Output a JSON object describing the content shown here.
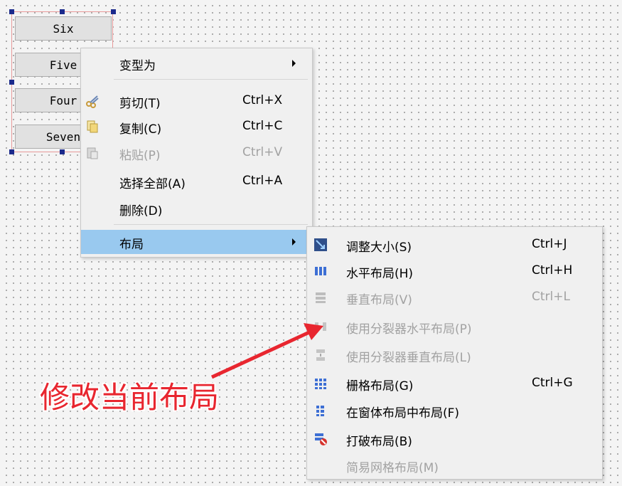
{
  "form": {
    "buttons": [
      {
        "label": "Six"
      },
      {
        "label": "Five"
      },
      {
        "label": "Four"
      },
      {
        "label": "Seven"
      }
    ]
  },
  "context_menu": {
    "items": [
      {
        "label": "变型为",
        "shortcut": "",
        "icon": "",
        "enabled": true,
        "submenu": true
      },
      {
        "label": "剪切(T)",
        "shortcut": "Ctrl+X",
        "icon": "scissors-icon",
        "enabled": true
      },
      {
        "label": "复制(C)",
        "shortcut": "Ctrl+C",
        "icon": "copy-icon",
        "enabled": true
      },
      {
        "label": "粘贴(P)",
        "shortcut": "Ctrl+V",
        "icon": "paste-icon",
        "enabled": false
      },
      {
        "label": "选择全部(A)",
        "shortcut": "Ctrl+A",
        "icon": "",
        "enabled": true
      },
      {
        "label": "删除(D)",
        "shortcut": "",
        "icon": "",
        "enabled": true
      },
      {
        "label": "布局",
        "shortcut": "",
        "icon": "",
        "enabled": true,
        "submenu": true,
        "highlighted": true
      }
    ]
  },
  "layout_submenu": {
    "items": [
      {
        "label": "调整大小(S)",
        "shortcut": "Ctrl+J",
        "icon": "adjust-size-icon",
        "enabled": true
      },
      {
        "label": "水平布局(H)",
        "shortcut": "Ctrl+H",
        "icon": "horizontal-layout-icon",
        "enabled": true
      },
      {
        "label": "垂直布局(V)",
        "shortcut": "Ctrl+L",
        "icon": "vertical-layout-icon",
        "enabled": false
      },
      {
        "label": "使用分裂器水平布局(P)",
        "shortcut": "",
        "icon": "horizontal-splitter-icon",
        "enabled": false
      },
      {
        "label": "使用分裂器垂直布局(L)",
        "shortcut": "",
        "icon": "vertical-splitter-icon",
        "enabled": false
      },
      {
        "label": "栅格布局(G)",
        "shortcut": "Ctrl+G",
        "icon": "grid-layout-icon",
        "enabled": true
      },
      {
        "label": "在窗体布局中布局(F)",
        "shortcut": "",
        "icon": "form-layout-icon",
        "enabled": true
      },
      {
        "label": "打破布局(B)",
        "shortcut": "",
        "icon": "break-layout-icon",
        "enabled": true
      },
      {
        "label": "简易网格布局(M)",
        "shortcut": "",
        "icon": "",
        "enabled": false
      }
    ]
  },
  "annotation": {
    "text": "修改当前布局",
    "color": "#e8262f"
  },
  "colors": {
    "highlight": "#99c9ef",
    "disabled_text": "#a2a2a2",
    "handle": "#1b2a8c"
  }
}
